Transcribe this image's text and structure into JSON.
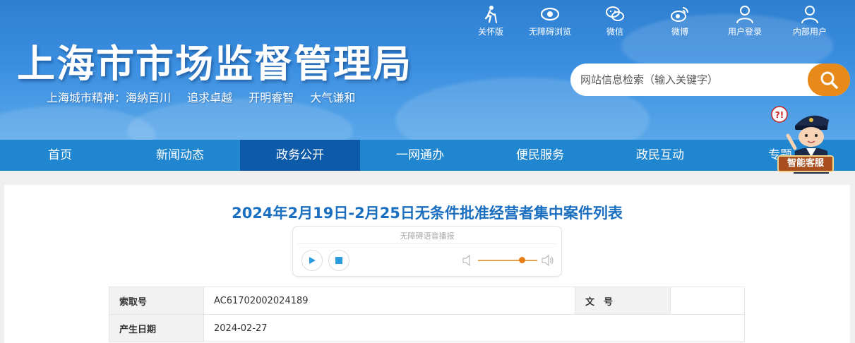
{
  "header": {
    "site_title": "上海市市场监督管理局",
    "motto": [
      "上海城市精神：海纳百川",
      "追求卓越",
      "开明睿智",
      "大气谦和"
    ],
    "toplinks": [
      {
        "label": "关怀版",
        "icon": "elderly-care-icon"
      },
      {
        "label": "无障碍浏览",
        "icon": "eye-icon"
      },
      {
        "label": "微信",
        "icon": "wechat-icon"
      },
      {
        "label": "微博",
        "icon": "weibo-icon"
      },
      {
        "label": "用户登录",
        "icon": "user-icon"
      },
      {
        "label": "内部用户",
        "icon": "user-icon"
      }
    ],
    "search": {
      "placeholder": "网站信息检索（输入关键字）",
      "button_icon": "search-icon"
    }
  },
  "nav": {
    "items": [
      "首页",
      "新闻动态",
      "政务公开",
      "一网通办",
      "便民服务",
      "政民互动",
      "专题"
    ],
    "active_index": 2
  },
  "agent": {
    "label": "智能客服"
  },
  "article": {
    "title": "2024年2月19日-2月25日无条件批准经营者集中案件列表"
  },
  "player": {
    "title": "无障碍语音播报",
    "volume": 0.75
  },
  "meta": {
    "rows": [
      {
        "label": "索取号",
        "value": "AC61702002024189",
        "label2": "文　号",
        "value2": ""
      },
      {
        "label": "产生日期",
        "value": "2024-02-27"
      }
    ]
  },
  "colors": {
    "nav_bg": "#1f86cf",
    "nav_active": "#0d5aa8",
    "search_button": "#e88a1a",
    "title_blue": "#1a6fc0"
  }
}
